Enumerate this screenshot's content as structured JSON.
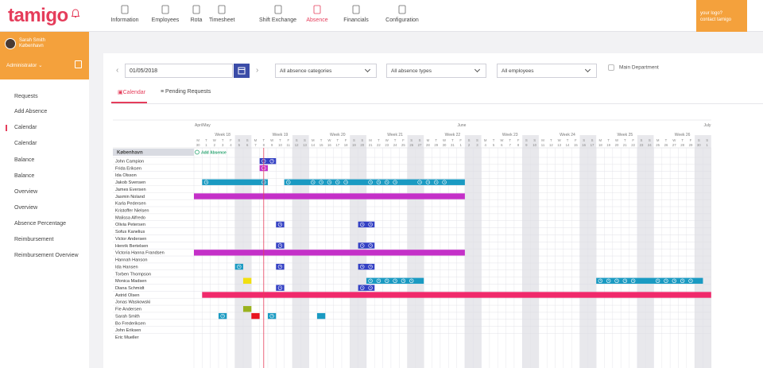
{
  "logo": "tamigo",
  "nav": [
    {
      "label": "Information",
      "icon": "info-icon",
      "active": false
    },
    {
      "label": "Employees",
      "icon": "employees-icon",
      "active": false
    },
    {
      "label": "Rota",
      "icon": "rota-icon",
      "active": false
    },
    {
      "label": "Timesheet",
      "icon": "timesheet-icon",
      "active": false
    },
    {
      "label": "Shift Exchange",
      "icon": "exchange-icon",
      "active": false
    },
    {
      "label": "Absence",
      "icon": "absence-icon",
      "active": true
    },
    {
      "label": "Financials",
      "icon": "financials-icon",
      "active": false
    },
    {
      "label": "Configuration",
      "icon": "gear-icon",
      "active": false
    }
  ],
  "promo": {
    "line1": "your logo?",
    "line2": "contact tamigo"
  },
  "user": {
    "name": "Sarah Smith",
    "location": "København",
    "role": "Administrator"
  },
  "sidebar": [
    "Requests",
    "Add Absence",
    "Calendar",
    "Calendar",
    "Balance",
    "Balance",
    "Overview",
    "Overview",
    "Absence Percentage",
    "Reimbursement",
    "Reimbursement Overview"
  ],
  "sidebar_active_index": 2,
  "filters": {
    "date": "01/05/2018",
    "categories": "All absence categories",
    "types": "All absence types",
    "employees": "All employees",
    "main_department": "Main Department"
  },
  "tabs": {
    "calendar": "Calendar",
    "pending": "Pending Requests"
  },
  "calendar": {
    "start_date": "2018-04-30",
    "days": 63,
    "months": [
      {
        "label": "April",
        "day": 0
      },
      {
        "label": "May",
        "day": 1
      },
      {
        "label": "June",
        "day": 32
      },
      {
        "label": "July",
        "day": 62
      }
    ],
    "weeks": [
      "Week 18",
      "Week 19",
      "Week 20",
      "Week 21",
      "Week 22",
      "Week 23",
      "Week 24",
      "Week 25",
      "Week 26"
    ],
    "dow": [
      "M",
      "T",
      "W",
      "T",
      "F",
      "S",
      "S"
    ],
    "daynums": [
      30,
      1,
      2,
      3,
      4,
      5,
      6,
      7,
      8,
      9,
      10,
      11,
      12,
      13,
      14,
      15,
      16,
      17,
      18,
      19,
      20,
      21,
      22,
      23,
      24,
      25,
      26,
      27,
      28,
      29,
      30,
      31,
      1,
      2,
      3,
      4,
      5,
      6,
      7,
      8,
      9,
      10,
      11,
      12,
      13,
      14,
      15,
      16,
      17,
      18,
      19,
      20,
      21,
      22,
      23,
      24,
      25,
      26,
      27,
      28,
      29,
      30,
      1
    ],
    "today_index": 8,
    "department": "København",
    "add_absence": "Add Absence",
    "employees": [
      "John Campion",
      "Frida Eriksen",
      "Ida Olsson",
      "Jakob Svensen",
      "James Eversen",
      "Jasmin Noland",
      "Karla Pedersen",
      "Kristoffer Nielsen",
      "Malissa Alfredo",
      "Olivia Petersen",
      "Sofus Kanelius",
      "Victor Andersen",
      "Henrik Bertelsen",
      "Victoria Hanna Frandsen",
      "Hannah Hanson",
      "Ida Hansen",
      "Torben Thompson",
      "Monica Madsen",
      "Diana Schmidt",
      "Astrid Olsen",
      "Jonas Waskowski",
      "Fie Andersen",
      "Sarah Smith",
      "Bo Frederiksen",
      "John Eriksen",
      "Eric Mueller"
    ],
    "colors": {
      "blue": "#3340c4",
      "magenta": "#c430c8",
      "teal": "#1a9ac2",
      "pink": "#f0296b",
      "yellow": "#f1df10",
      "olive": "#9ab21e",
      "red": "#e8141e"
    },
    "events": [
      {
        "row": 0,
        "start": 8,
        "end": 8,
        "color": "blue",
        "icon": true
      },
      {
        "row": 0,
        "start": 9,
        "end": 9,
        "color": "blue",
        "icon": true
      },
      {
        "row": 1,
        "start": 8,
        "end": 8,
        "color": "magenta",
        "icon": true
      },
      {
        "row": 3,
        "start": 1,
        "end": 8,
        "color": "teal",
        "icons": [
          1,
          8
        ]
      },
      {
        "row": 3,
        "start": 11,
        "end": 32,
        "color": "teal",
        "icons": [
          11,
          14,
          15,
          16,
          17,
          18,
          21,
          22,
          23,
          24,
          27,
          28,
          29,
          30
        ]
      },
      {
        "row": 5,
        "start": 0,
        "end": 32,
        "color": "magenta"
      },
      {
        "row": 9,
        "start": 10,
        "end": 10,
        "color": "blue",
        "icon": true
      },
      {
        "row": 9,
        "start": 20,
        "end": 21,
        "color": "blue",
        "icons": [
          20,
          21
        ]
      },
      {
        "row": 12,
        "start": 10,
        "end": 10,
        "color": "blue",
        "icon": true
      },
      {
        "row": 12,
        "start": 20,
        "end": 21,
        "color": "blue",
        "icons": [
          20,
          21
        ]
      },
      {
        "row": 13,
        "start": 0,
        "end": 32,
        "color": "magenta"
      },
      {
        "row": 15,
        "start": 5,
        "end": 5,
        "color": "teal",
        "icon": true
      },
      {
        "row": 15,
        "start": 10,
        "end": 10,
        "color": "blue",
        "icon": true
      },
      {
        "row": 15,
        "start": 20,
        "end": 21,
        "color": "blue",
        "icons": [
          20,
          21
        ]
      },
      {
        "row": 17,
        "start": 6,
        "end": 6,
        "color": "yellow"
      },
      {
        "row": 17,
        "start": 21,
        "end": 27,
        "color": "teal",
        "icons": [
          21,
          22,
          23,
          24,
          25,
          26
        ]
      },
      {
        "row": 17,
        "start": 49,
        "end": 61,
        "color": "teal",
        "icons": [
          49,
          50,
          51,
          52,
          53,
          56,
          57,
          58,
          59,
          60
        ]
      },
      {
        "row": 18,
        "start": 10,
        "end": 10,
        "color": "blue",
        "icon": true
      },
      {
        "row": 18,
        "start": 20,
        "end": 21,
        "color": "blue",
        "icons": [
          20,
          21
        ]
      },
      {
        "row": 19,
        "start": 1,
        "end": 62,
        "color": "pink"
      },
      {
        "row": 21,
        "start": 6,
        "end": 6,
        "color": "olive"
      },
      {
        "row": 22,
        "start": 3,
        "end": 3,
        "color": "teal",
        "icon": true
      },
      {
        "row": 22,
        "start": 7,
        "end": 7,
        "color": "red"
      },
      {
        "row": 22,
        "start": 9,
        "end": 9,
        "color": "teal",
        "icon": true
      },
      {
        "row": 22,
        "start": 15,
        "end": 15,
        "color": "teal"
      }
    ]
  }
}
